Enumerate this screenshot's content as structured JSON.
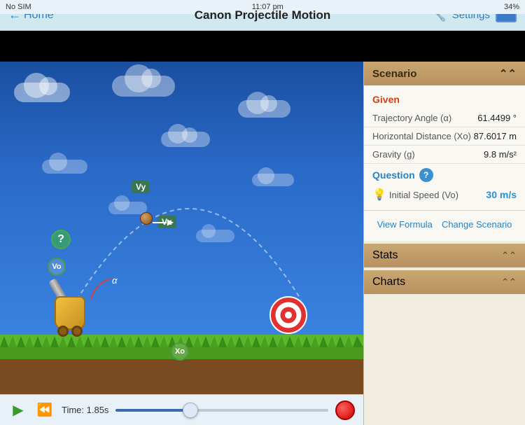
{
  "statusBar": {
    "carrier": "No SIM",
    "wifi": "WiFi",
    "time": "11:07 pm",
    "battery": "34%"
  },
  "topBar": {
    "homeLabel": "Home",
    "title": "Canon Projectile Motion",
    "settingsLabel": "Settings"
  },
  "rightPanel": {
    "scenarioHeader": "Scenario",
    "givenLabel": "Given",
    "trajectoryAngleLabel": "Trajectory Angle (α)",
    "trajectoryAngleValue": "61.4499 °",
    "horizontalDistLabel": "Horizontal Distance (Xo)",
    "horizontalDistValue": "87.6017 m",
    "gravityLabel": "Gravity (g)",
    "gravityValue": "9.8 m/s²",
    "questionLabel": "Question",
    "initialSpeedLabel": "Initial Speed (Vo)",
    "initialSpeedValue": "30 m/s",
    "viewFormulaLabel": "View Formula",
    "changeScenarioLabel": "Change Scenario",
    "statsHeader": "Stats",
    "chartsHeader": "Charts"
  },
  "bottomBar": {
    "timeLabel": "Time: 1.85s",
    "sliderPercent": 35
  },
  "canvas": {
    "labelVy": "Vy",
    "labelVx": "Vx",
    "labelVo": "Vo",
    "labelAlpha": "α",
    "labelXo": "Xo"
  }
}
